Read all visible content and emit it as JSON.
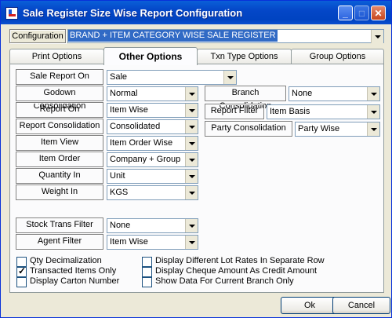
{
  "window": {
    "title": "Sale Register Size Wise Report Configuration",
    "minimize": "_",
    "maximize": "□",
    "close": "✕"
  },
  "configuration": {
    "label": "Configuration",
    "value": "BRAND + ITEM CATEGORY WISE SALE REGISTER"
  },
  "tabs": [
    {
      "label": "Print Options",
      "active": false
    },
    {
      "label": "Other Options",
      "active": true
    },
    {
      "label": "Txn Type Options",
      "active": false
    },
    {
      "label": "Group Options",
      "active": false
    }
  ],
  "left_fields": [
    {
      "label": "Sale Report On",
      "value": "Sale"
    },
    {
      "label": "Godown Consolidation",
      "value": "Normal"
    },
    {
      "label": "Report On",
      "value": "Item Wise"
    },
    {
      "label": "Report Consolidation",
      "value": "Consolidated"
    },
    {
      "label": "Item View",
      "value": "Item Order Wise"
    },
    {
      "label": "Item Order",
      "value": "Company + Group"
    },
    {
      "label": "Quantity In",
      "value": "Unit"
    },
    {
      "label": "Weight In",
      "value": "KGS"
    },
    {
      "label": "Stock Trans Filter",
      "value": "None"
    },
    {
      "label": "Agent Filter",
      "value": "Item Wise"
    }
  ],
  "right_fields": [
    {
      "label": "Branch Consolidation",
      "value": "None"
    },
    {
      "label": "Report Filter",
      "value": "Item Basis"
    },
    {
      "label": "Party Consolidation",
      "value": "Party Wise"
    }
  ],
  "checkboxes_left": [
    {
      "label": "Qty Decimalization",
      "checked": false
    },
    {
      "label": "Transacted Items Only",
      "checked": true
    },
    {
      "label": "Display Carton Number",
      "checked": false
    }
  ],
  "checkboxes_right": [
    {
      "label": "Display Different Lot Rates In Separate Row",
      "checked": false
    },
    {
      "label": "Display Cheque Amount As Credit Amount",
      "checked": false
    },
    {
      "label": "Show Data For Current Branch Only",
      "checked": false
    }
  ],
  "buttons": {
    "ok": "Ok",
    "cancel": "Cancel"
  }
}
